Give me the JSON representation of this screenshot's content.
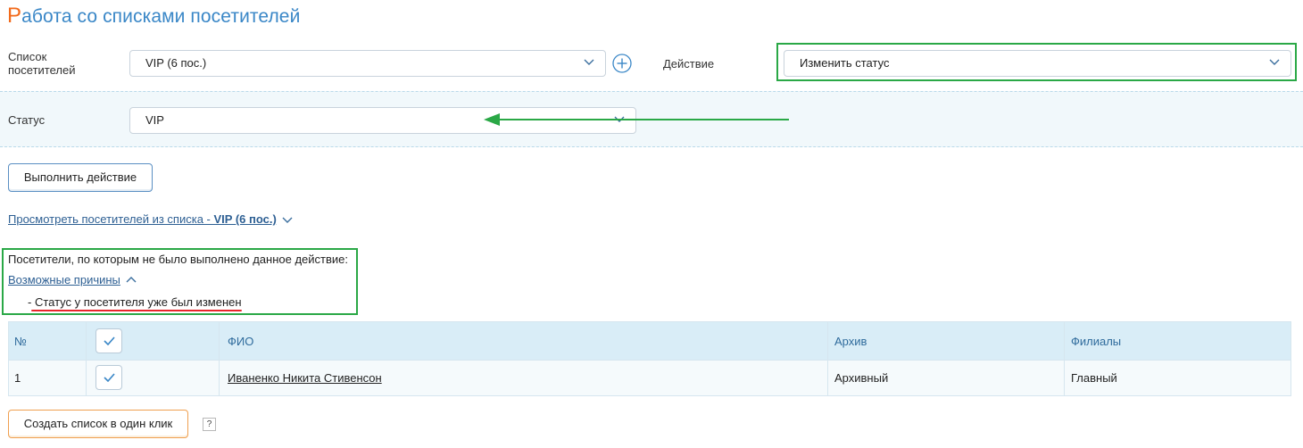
{
  "page": {
    "title_first_letter": "Р",
    "title_rest": "абота со списками посетителей"
  },
  "visitor_list": {
    "label_line1": "Список",
    "label_line2": "посетителей",
    "selected": "VIP (6 пос.)"
  },
  "action": {
    "label": "Действие",
    "selected": "Изменить статус"
  },
  "status": {
    "label": "Статус",
    "selected": "VIP"
  },
  "execute_button": "Выполнить действие",
  "view_link": {
    "prefix": "Просмотреть посетителей из списка - ",
    "list_name": "VIP (6 пос.)"
  },
  "notice": {
    "text": "Посетители, по которым не было выполнено данное действие:",
    "reasons_link": "Возможные причины",
    "reason": "- Статус у посетителя уже был изменен"
  },
  "table": {
    "headers": {
      "num": "№",
      "fio": "ФИО",
      "archive": "Архив",
      "branches": "Филиалы"
    },
    "rows": [
      {
        "num": "1",
        "fio": "Иваненко Никита Стивенсон",
        "archive": "Архивный",
        "branches": "Главный"
      }
    ]
  },
  "create_button": "Создать список в один клик",
  "help_mark": "?",
  "colors": {
    "accent_orange": "#f26a1b",
    "title_blue": "#3a87c7",
    "highlight_green": "#2aa846",
    "underline_red": "#e8262a",
    "table_header_bg": "#d9edf7"
  }
}
